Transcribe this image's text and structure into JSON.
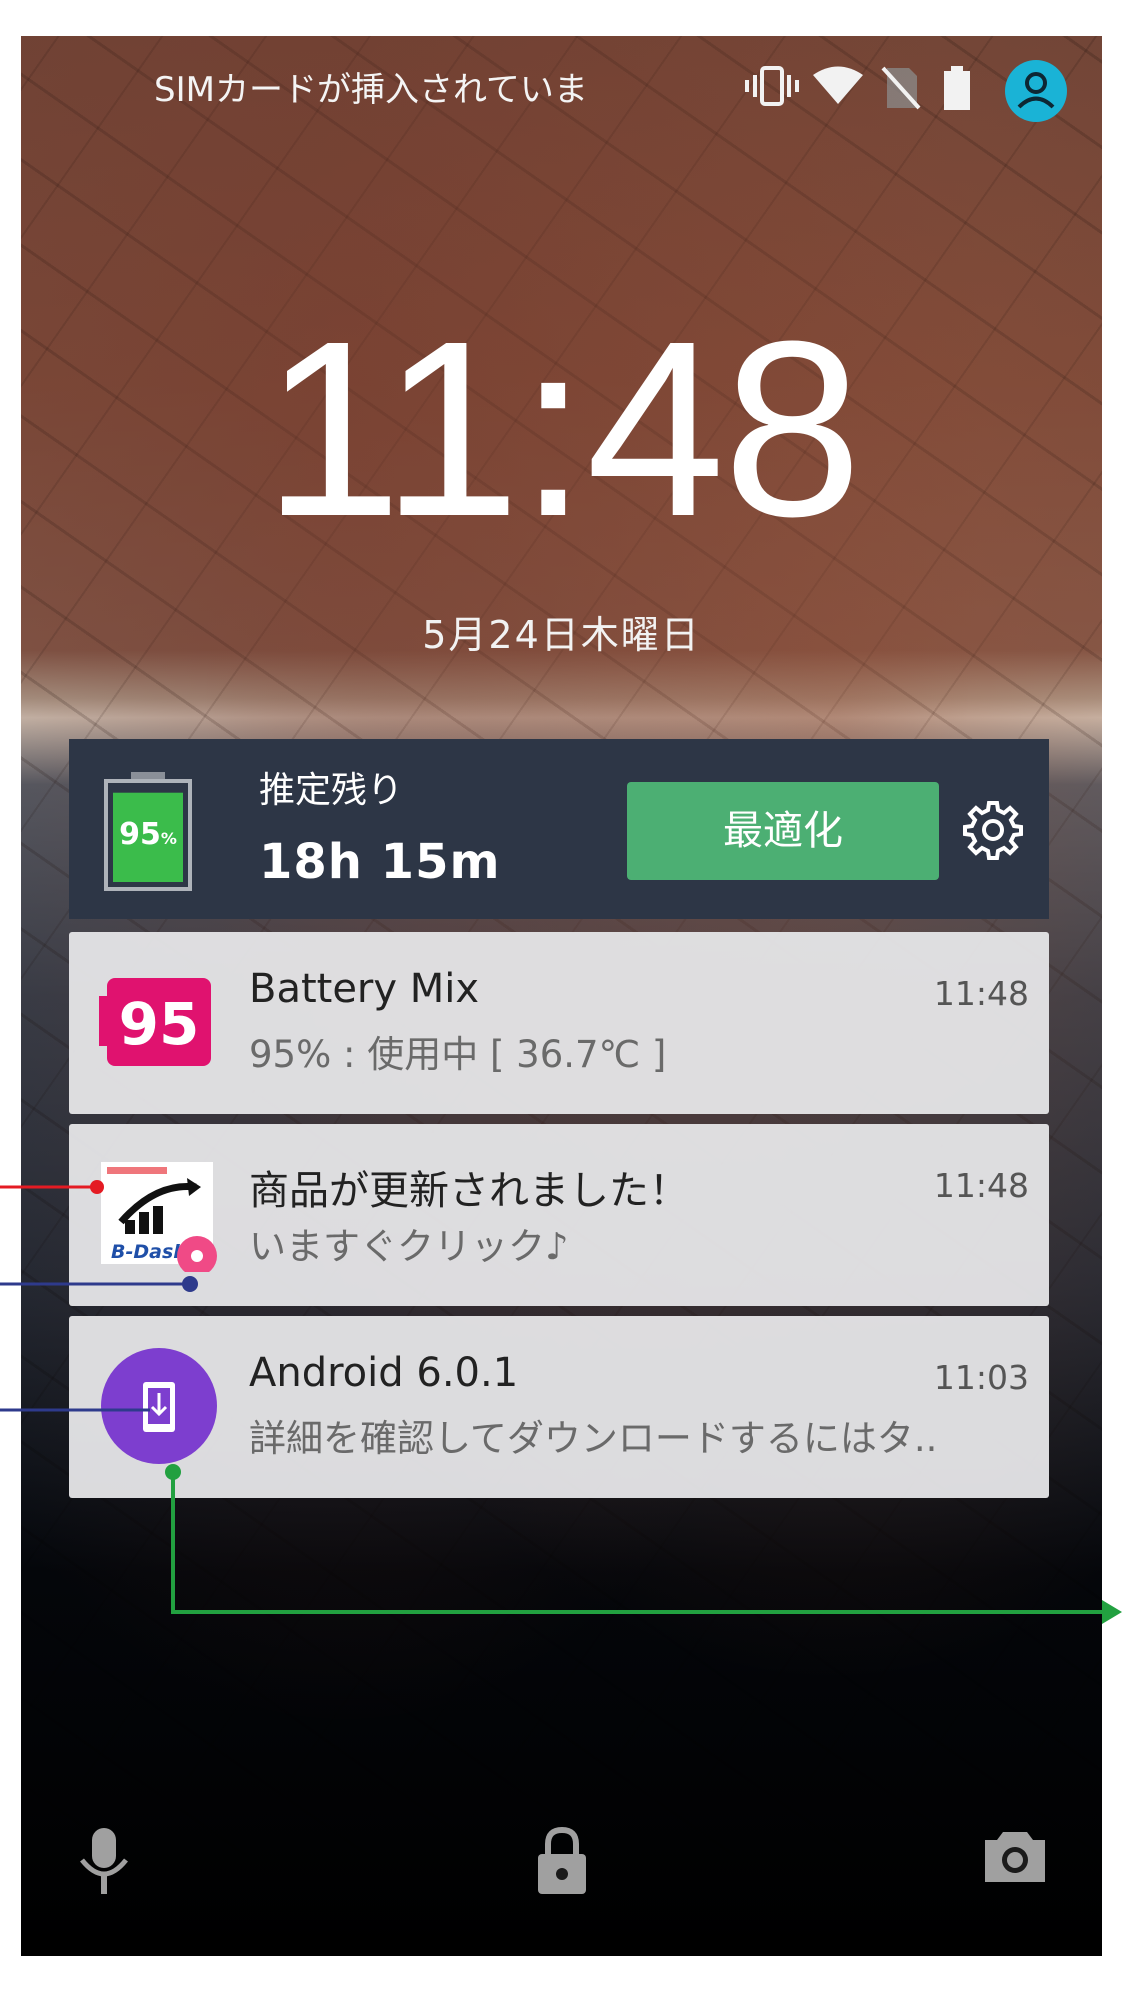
{
  "status_bar": {
    "carrier_text": "SIMカードが挿入されていま",
    "icons": [
      "vibrate-icon",
      "wifi-icon",
      "no-sim-icon",
      "battery-icon",
      "user-avatar-icon"
    ],
    "accent_color": "#1ab3d6"
  },
  "lockscreen": {
    "time": "11:48",
    "date": "5月24日木曜日"
  },
  "battery_widget": {
    "level_label": "95",
    "level_unit": "%",
    "level_fraction": 0.95,
    "remaining_label": "推定残り",
    "remaining_time": "18h 15m",
    "optimize_button": "最適化",
    "settings_icon": "gear-icon",
    "bar_color": "#3bbc4b",
    "button_color": "#4caf73"
  },
  "notifications": [
    {
      "icon": "battery-mix-icon",
      "icon_text": "95",
      "title": "Battery Mix",
      "body": "95% : 使用中 [ 36.7℃ ]",
      "time": "11:48"
    },
    {
      "icon": "bdash-app-icon",
      "icon_text": "B-Dash",
      "title": "商品が更新されました！",
      "body": "いますぐクリック♪",
      "time": "11:48"
    },
    {
      "icon": "system-update-icon",
      "title": "Android 6.0.1",
      "body": "詳細を確認してダウンロードするにはタ..",
      "time": "11:03"
    }
  ],
  "bottom_bar": {
    "icons": [
      "microphone-icon",
      "lock-icon",
      "camera-icon"
    ]
  },
  "annotation_colors": {
    "red": "#e41b23",
    "blue": "#2e3a8c",
    "green": "#22a040"
  }
}
